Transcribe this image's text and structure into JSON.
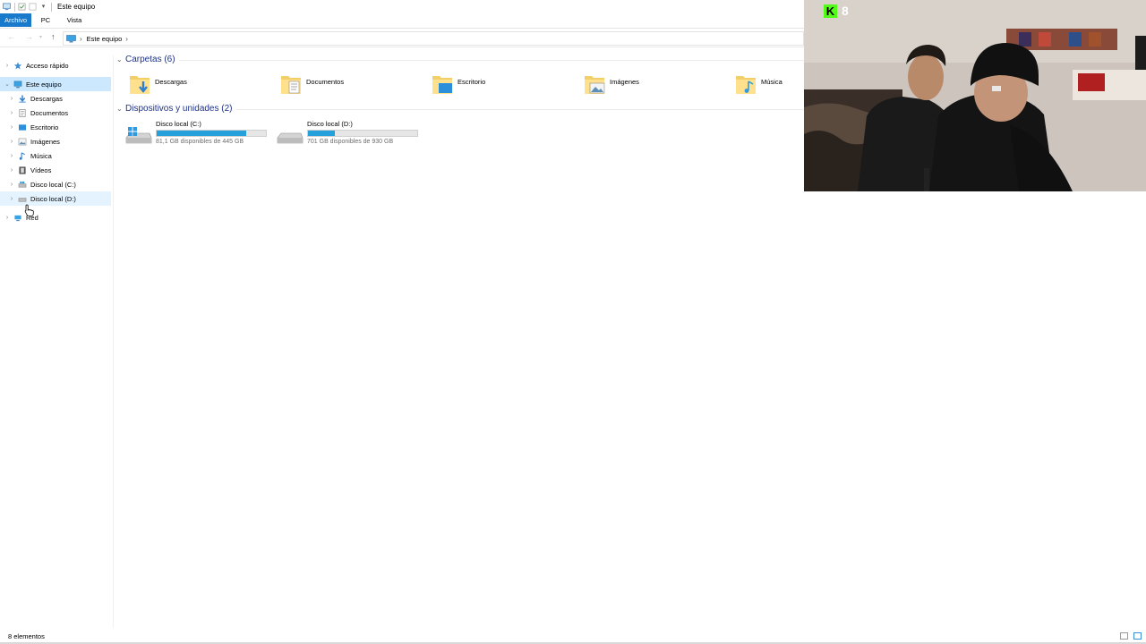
{
  "window": {
    "title": "Este equipo"
  },
  "ribbon": {
    "tabs": [
      "Archivo",
      "PC",
      "Vista"
    ]
  },
  "address": {
    "path": "Este equipo"
  },
  "sidebar": {
    "items": [
      {
        "label": "Acceso rápido"
      },
      {
        "label": "Este equipo"
      },
      {
        "label": "Descargas"
      },
      {
        "label": "Documentos"
      },
      {
        "label": "Escritorio"
      },
      {
        "label": "Imágenes"
      },
      {
        "label": "Música"
      },
      {
        "label": "Vídeos"
      },
      {
        "label": "Disco local (C:)"
      },
      {
        "label": "Disco local (D:)"
      },
      {
        "label": "Red"
      }
    ]
  },
  "main": {
    "folders_group": "Carpetas (6)",
    "folders": [
      {
        "label": "Descargas",
        "icon": "download-folder-icon"
      },
      {
        "label": "Documentos",
        "icon": "documents-folder-icon"
      },
      {
        "label": "Escritorio",
        "icon": "desktop-folder-icon"
      },
      {
        "label": "Imágenes",
        "icon": "pictures-folder-icon"
      },
      {
        "label": "Música",
        "icon": "music-folder-icon"
      }
    ],
    "devices_group": "Dispositivos y unidades (2)",
    "drives": [
      {
        "name": "Disco local (C:)",
        "free": "81,1 GB disponibles de 445 GB",
        "used_fraction": 0.818
      },
      {
        "name": "Disco local (D:)",
        "free": "701 GB disponibles de 930 GB",
        "used_fraction": 0.246
      }
    ]
  },
  "status": {
    "count": "8 elementos"
  },
  "overlay": {
    "viewer_count": "8"
  },
  "colors": {
    "accent": "#1979ca",
    "bar_fill": "#26a0da",
    "selected": "#cce8ff",
    "group_head": "#1e3287",
    "kick": "#53fc18"
  }
}
